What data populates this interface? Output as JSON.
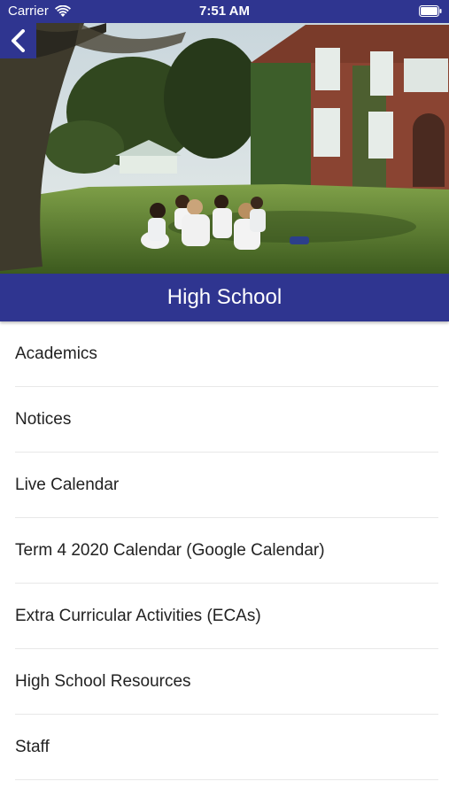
{
  "status_bar": {
    "carrier": "Carrier",
    "time": "7:51 AM",
    "wifi_icon": "wifi-icon",
    "battery_icon": "battery-icon"
  },
  "header": {
    "back_icon": "chevron-left-icon",
    "title": "High School",
    "hero_image": "school-campus-photo"
  },
  "menu": {
    "items": [
      {
        "label": "Academics"
      },
      {
        "label": "Notices"
      },
      {
        "label": "Live Calendar"
      },
      {
        "label": "Term 4 2020 Calendar (Google Calendar)"
      },
      {
        "label": "Extra Curricular Activities (ECAs)"
      },
      {
        "label": "High School Resources"
      },
      {
        "label": "Staff"
      }
    ]
  },
  "colors": {
    "brand": "#2f3590",
    "divider": "#e8e8e8",
    "text": "#222222"
  }
}
